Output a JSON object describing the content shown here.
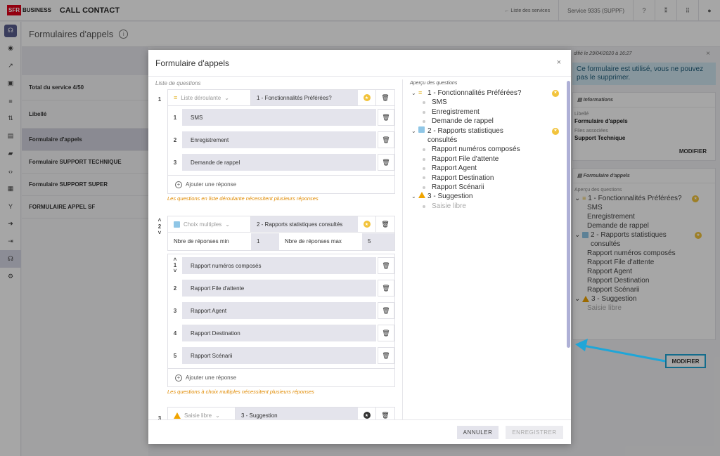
{
  "topbar": {
    "logo": "SFR",
    "brand": "BUSINESS",
    "app_title": "CALL CONTACT",
    "services_link": "← Liste des services",
    "service_name": "Service 9335 (SUPPF)"
  },
  "page": {
    "title": "Formulaires d'appels"
  },
  "background_list": {
    "rows": [
      "Total du service 4/50",
      "Libellé",
      "Formulaire d'appels",
      "Formulaire SUPPORT TECHNIQUE",
      "Formulaire SUPPORT SUPER",
      "FORMULAIRE APPEL SF"
    ]
  },
  "right_panel": {
    "modified": "difié le 29/04/2020 à 16:27",
    "alert": "Ce formulaire est utilisé, vous ne pouvez pas le supprimer.",
    "info_title": "Informations",
    "libelle_label": "Libellé",
    "libelle_value": "Formulaire d'appels",
    "files_label": "Files associées",
    "files_value": "Support Technique",
    "modifier": "MODIFIER",
    "form_title": "Formulaire d'appels",
    "preview_label": "Aperçu des questions",
    "q1": "1 - Fonctionnalités Préférées?",
    "q1_answers": [
      "SMS",
      "Enregistrement",
      "Demande de rappel"
    ],
    "q2": "2 - Rapports statistiques consultés",
    "q2_answers": [
      "Rapport numéros composés",
      "Rapport File d'attente",
      "Rapport Agent",
      "Rapport Destination",
      "Rapport Scénarii"
    ],
    "q3": "3 - Suggestion",
    "q3_answers": [
      "Saisie libre"
    ],
    "modifier_highlight": "MODIFIER"
  },
  "modal": {
    "title": "Formulaire d'appels",
    "list_label": "Liste de questions",
    "q1": {
      "num": "1",
      "type": "Liste déroulante",
      "name": "1 - Fonctionnalités Préférées?",
      "answers": [
        {
          "num": "1",
          "text": "SMS"
        },
        {
          "num": "2",
          "text": "Enregistrement"
        },
        {
          "num": "3",
          "text": "Demande de rappel"
        }
      ],
      "add": "Ajouter une réponse",
      "warning": "Les questions en liste déroulante nécessitent plusieurs réponses"
    },
    "q2": {
      "num": "2",
      "type": "Choix multiples",
      "name": "2 - Rapports statistiques consultés",
      "min_label": "Nbre de réponses min",
      "min_value": "1",
      "max_label": "Nbre de réponses max",
      "max_value": "5",
      "answers": [
        {
          "num": "1",
          "text": "Rapport numéros composés"
        },
        {
          "num": "2",
          "text": "Rapport File d'attente"
        },
        {
          "num": "3",
          "text": "Rapport Agent"
        },
        {
          "num": "4",
          "text": "Rapport Destination"
        },
        {
          "num": "5",
          "text": "Rapport Scénarii"
        }
      ],
      "add": "Ajouter une réponse",
      "warning": "Les questions à choix multiples nécessitent plusieurs réponses"
    },
    "q3": {
      "num": "3",
      "type": "Saisie libre",
      "name": "3 - Suggestion"
    },
    "preview": {
      "label": "Aperçu des questions",
      "q1": "1 - Fonctionnalités Préférées?",
      "q1_answers": [
        "SMS",
        "Enregistrement",
        "Demande de rappel"
      ],
      "q2": "2 - Rapports statistiques consultés",
      "q2_answers": [
        "Rapport numéros composés",
        "Rapport File d'attente",
        "Rapport Agent",
        "Rapport Destination",
        "Rapport Scénarii"
      ],
      "q3": "3 - Suggestion",
      "q3_answers": [
        "Saisie libre"
      ]
    },
    "cancel": "ANNULER",
    "save": "ENREGISTRER"
  },
  "colors": {
    "accent": "#5a5f8f",
    "warning": "#e08a00",
    "highlight": "#1fa6d8",
    "star": "#f2c33b"
  }
}
